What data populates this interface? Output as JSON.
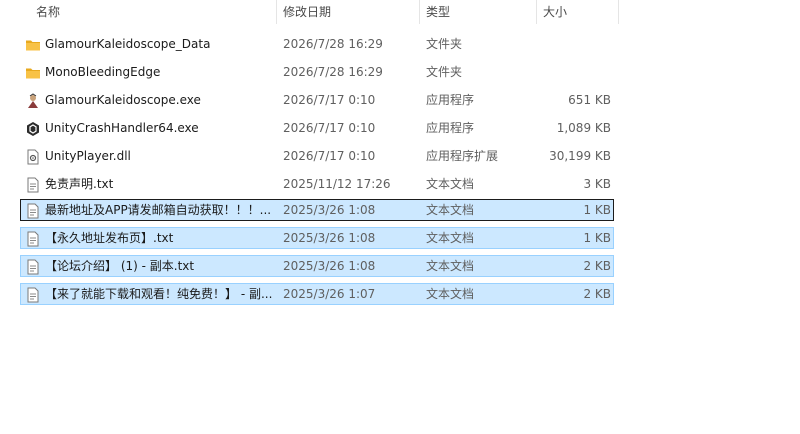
{
  "columns": {
    "name": "名称",
    "date": "修改日期",
    "type": "类型",
    "size": "大小"
  },
  "colors": {
    "selection_bg": "#cce8ff",
    "selection_border": "#99d1ff",
    "folder": "#f8c246"
  },
  "files": [
    {
      "name": "GlamourKaleidoscope_Data",
      "date": "2026/7/28 16:29",
      "type": "文件夹",
      "size": "",
      "icon": "folder-icon"
    },
    {
      "name": "MonoBleedingEdge",
      "date": "2026/7/28 16:29",
      "type": "文件夹",
      "size": "",
      "icon": "folder-icon"
    },
    {
      "name": "GlamourKaleidoscope.exe",
      "date": "2026/7/17 0:10",
      "type": "应用程序",
      "size": "651 KB",
      "icon": "game-exe-icon"
    },
    {
      "name": "UnityCrashHandler64.exe",
      "date": "2026/7/17 0:10",
      "type": "应用程序",
      "size": "1,089 KB",
      "icon": "unity-icon"
    },
    {
      "name": "UnityPlayer.dll",
      "date": "2026/7/17 0:10",
      "type": "应用程序扩展",
      "size": "30,199 KB",
      "icon": "dll-file-icon"
    },
    {
      "name": "免责声明.txt",
      "date": "2025/11/12 17:26",
      "type": "文本文档",
      "size": "3 KB",
      "icon": "text-file-icon"
    },
    {
      "name": "最新地址及APP请发邮箱自动获取！！！...",
      "date": "2025/3/26 1:08",
      "type": "文本文档",
      "size": "1 KB",
      "icon": "text-file-icon"
    },
    {
      "name": "【永久地址发布页】.txt",
      "date": "2025/3/26 1:08",
      "type": "文本文档",
      "size": "1 KB",
      "icon": "text-file-icon"
    },
    {
      "name": "【论坛介绍】 (1) - 副本.txt",
      "date": "2025/3/26 1:08",
      "type": "文本文档",
      "size": "2 KB",
      "icon": "text-file-icon"
    },
    {
      "name": "【来了就能下载和观看！纯免费！】 - 副...",
      "date": "2025/3/26 1:07",
      "type": "文本文档",
      "size": "2 KB",
      "icon": "text-file-icon"
    }
  ]
}
